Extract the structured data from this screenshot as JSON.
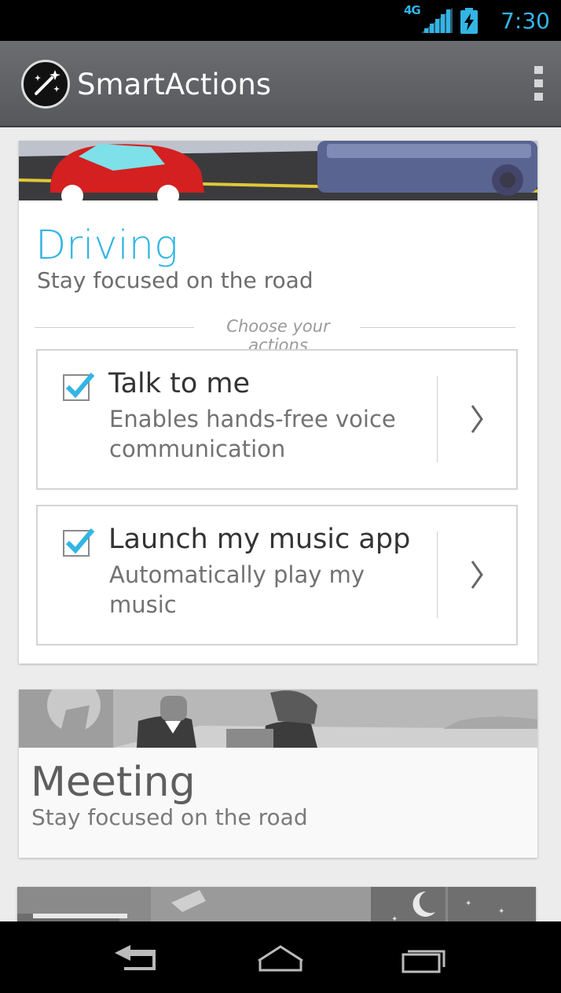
{
  "status_bar": {
    "network": "4G",
    "time": "7:30",
    "icons": [
      "signal-icon",
      "battery-charging-icon"
    ]
  },
  "action_bar": {
    "title": "SmartActions",
    "logo_icon": "magic-wand-icon",
    "menu_icon": "overflow-menu-icon"
  },
  "cards": [
    {
      "title": "Driving",
      "subtitle": "Stay focused on the road",
      "section_label": "Choose your actions",
      "actions": [
        {
          "label": "Talk to me",
          "description": "Enables hands-free voice communication",
          "checked": true
        },
        {
          "label": "Launch my music app",
          "description": "Automatically play my music",
          "checked": true
        }
      ]
    },
    {
      "title": "Meeting",
      "subtitle": "Stay focused on the road"
    }
  ],
  "nav_bar": {
    "icons": [
      "back-icon",
      "home-icon",
      "recent-apps-icon"
    ]
  },
  "colors": {
    "accent": "#33b5e5",
    "action_bar": "#5f6165"
  }
}
